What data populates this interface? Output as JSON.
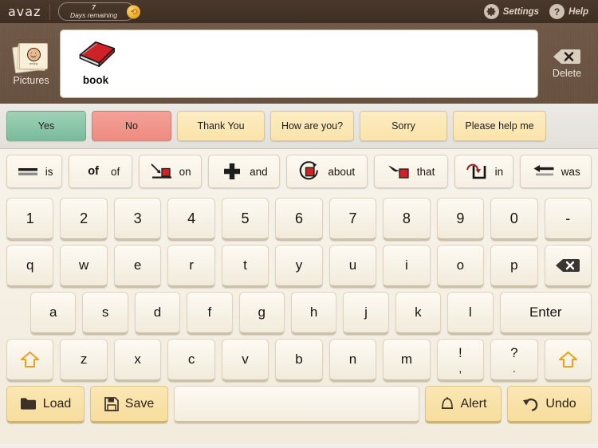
{
  "app": {
    "brand": "avaz",
    "trial": {
      "days": "7",
      "label": "Days remaining",
      "coin_icon": "refresh-coin-icon"
    },
    "settings_label": "Settings",
    "settings_icon": "gear-icon",
    "help_label": "Help",
    "help_icon": "question-mark-icon"
  },
  "message_area": {
    "pictures_label": "Pictures",
    "pictures_icon": "picture-cards-smiley-icon",
    "items": [
      {
        "word": "book",
        "icon": "red-book-icon"
      }
    ],
    "delete_label": "Delete",
    "delete_icon": "backspace-x-icon"
  },
  "quick_phrases": [
    {
      "label": "Yes",
      "style": "yes",
      "color": "#8ecaaf"
    },
    {
      "label": "No",
      "style": "no",
      "color": "#f0948a"
    },
    {
      "label": "Thank You",
      "style": "neutral",
      "color": "#fce7b6"
    },
    {
      "label": "How are you?",
      "style": "neutral",
      "color": "#fce7b6"
    },
    {
      "label": "Sorry",
      "style": "neutral",
      "color": "#fce7b6"
    },
    {
      "label": "Please help me",
      "style": "neutral",
      "color": "#fce7b6"
    }
  ],
  "predictions": [
    {
      "word": "is",
      "icon": "equals-bars-icon",
      "bold": false
    },
    {
      "word": "of",
      "icon": "bold-of-text-icon",
      "bold": true,
      "glyph": "of"
    },
    {
      "word": "on",
      "icon": "arrow-onto-block-icon",
      "bold": false
    },
    {
      "word": "and",
      "icon": "plus-cross-icon",
      "bold": false
    },
    {
      "word": "about",
      "icon": "circular-arrow-around-block-icon",
      "bold": false
    },
    {
      "word": "that",
      "icon": "pointing-hand-block-icon",
      "bold": false
    },
    {
      "word": "in",
      "icon": "arrow-into-container-icon",
      "bold": false
    },
    {
      "word": "was",
      "icon": "left-arrow-bar-icon",
      "bold": false
    }
  ],
  "keyboard": {
    "row_numbers": [
      "1",
      "2",
      "3",
      "4",
      "5",
      "6",
      "7",
      "8",
      "9",
      "0",
      "-"
    ],
    "row_q": [
      "q",
      "w",
      "e",
      "r",
      "t",
      "y",
      "u",
      "i",
      "o",
      "p"
    ],
    "backspace_icon": "backspace-x-icon",
    "row_a": [
      "a",
      "s",
      "d",
      "f",
      "g",
      "h",
      "j",
      "k",
      "l"
    ],
    "enter_label": "Enter",
    "row_z": [
      "z",
      "x",
      "c",
      "v",
      "b",
      "n",
      "m"
    ],
    "shift_icon": "shift-up-arrow-icon",
    "punct_keys": [
      {
        "top": "!",
        "bottom": ","
      },
      {
        "top": "?",
        "bottom": "."
      }
    ],
    "space_label": ""
  },
  "bottom_bar": {
    "load_label": "Load",
    "load_icon": "folder-icon",
    "save_label": "Save",
    "save_icon": "floppy-disk-icon",
    "alert_label": "Alert",
    "alert_icon": "bell-icon",
    "undo_label": "Undo",
    "undo_icon": "undo-arrow-icon"
  },
  "colors": {
    "topbar": "#433226",
    "message_area": "#6a5342",
    "key_face": "#f8f2e6",
    "accent_orange": "#e8a31f",
    "quick_neutral": "#fce7b6"
  }
}
